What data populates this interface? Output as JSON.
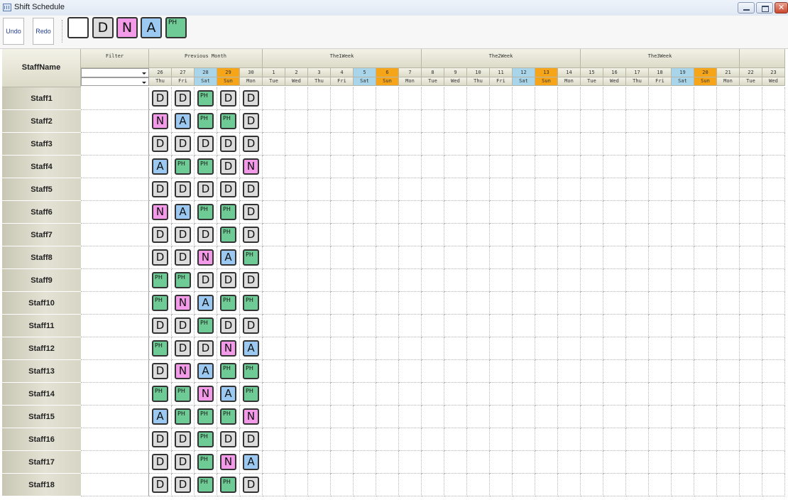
{
  "window": {
    "title": "Shift Schedule"
  },
  "toolbar": {
    "undo_label": "Undo",
    "redo_label": "Redo"
  },
  "palette": [
    {
      "code": "",
      "name": "empty"
    },
    {
      "code": "D",
      "name": "D"
    },
    {
      "code": "N",
      "name": "N"
    },
    {
      "code": "A",
      "name": "A"
    },
    {
      "code": "PH",
      "name": "PH"
    }
  ],
  "colors": {
    "D": "#dcdcdc",
    "N": "#f39ae9",
    "A": "#9cc9f1",
    "PH": "#6fcb95",
    "saturday": "#a9d5ea",
    "sunday": "#f6a418"
  },
  "grid": {
    "staff_header": "StaffName",
    "filter_header": "Filter",
    "groups": [
      "Previous Month",
      "The1Week",
      "The2Week",
      "The3Week",
      ""
    ],
    "days": [
      {
        "num": "26",
        "dow": "Thu",
        "type": "weekday"
      },
      {
        "num": "27",
        "dow": "Fri",
        "type": "weekday"
      },
      {
        "num": "28",
        "dow": "Sat",
        "type": "sat"
      },
      {
        "num": "29",
        "dow": "Sun",
        "type": "sun"
      },
      {
        "num": "30",
        "dow": "Mon",
        "type": "weekday"
      },
      {
        "num": "1",
        "dow": "Tue",
        "type": "weekday"
      },
      {
        "num": "2",
        "dow": "Wed",
        "type": "weekday"
      },
      {
        "num": "3",
        "dow": "Thu",
        "type": "weekday"
      },
      {
        "num": "4",
        "dow": "Fri",
        "type": "weekday"
      },
      {
        "num": "5",
        "dow": "Sat",
        "type": "sat"
      },
      {
        "num": "6",
        "dow": "Sun",
        "type": "sun"
      },
      {
        "num": "7",
        "dow": "Mon",
        "type": "weekday"
      },
      {
        "num": "8",
        "dow": "Tue",
        "type": "weekday"
      },
      {
        "num": "9",
        "dow": "Wed",
        "type": "weekday"
      },
      {
        "num": "10",
        "dow": "Thu",
        "type": "weekday"
      },
      {
        "num": "11",
        "dow": "Fri",
        "type": "weekday"
      },
      {
        "num": "12",
        "dow": "Sat",
        "type": "sat"
      },
      {
        "num": "13",
        "dow": "Sun",
        "type": "sun"
      },
      {
        "num": "14",
        "dow": "Mon",
        "type": "weekday"
      },
      {
        "num": "15",
        "dow": "Tue",
        "type": "weekday"
      },
      {
        "num": "16",
        "dow": "Wed",
        "type": "weekday"
      },
      {
        "num": "17",
        "dow": "Thu",
        "type": "weekday"
      },
      {
        "num": "18",
        "dow": "Fri",
        "type": "weekday"
      },
      {
        "num": "19",
        "dow": "Sat",
        "type": "sat"
      },
      {
        "num": "20",
        "dow": "Sun",
        "type": "sun"
      },
      {
        "num": "21",
        "dow": "Mon",
        "type": "weekday"
      },
      {
        "num": "22",
        "dow": "Tue",
        "type": "weekday"
      },
      {
        "num": "23",
        "dow": "Wed",
        "type": "weekday"
      }
    ],
    "staff": [
      {
        "name": "Staff1",
        "shifts": [
          "D",
          "D",
          "PH",
          "D",
          "D"
        ]
      },
      {
        "name": "Staff2",
        "shifts": [
          "N",
          "A",
          "PH",
          "PH",
          "D"
        ]
      },
      {
        "name": "Staff3",
        "shifts": [
          "D",
          "D",
          "D",
          "D",
          "D"
        ]
      },
      {
        "name": "Staff4",
        "shifts": [
          "A",
          "PH",
          "PH",
          "D",
          "N"
        ]
      },
      {
        "name": "Staff5",
        "shifts": [
          "D",
          "D",
          "D",
          "D",
          "D"
        ]
      },
      {
        "name": "Staff6",
        "shifts": [
          "N",
          "A",
          "PH",
          "PH",
          "D"
        ]
      },
      {
        "name": "Staff7",
        "shifts": [
          "D",
          "D",
          "D",
          "PH",
          "D"
        ]
      },
      {
        "name": "Staff8",
        "shifts": [
          "D",
          "D",
          "N",
          "A",
          "PH"
        ]
      },
      {
        "name": "Staff9",
        "shifts": [
          "PH",
          "PH",
          "D",
          "D",
          "D"
        ]
      },
      {
        "name": "Staff10",
        "shifts": [
          "PH",
          "N",
          "A",
          "PH",
          "PH"
        ]
      },
      {
        "name": "Staff11",
        "shifts": [
          "D",
          "D",
          "PH",
          "D",
          "D"
        ]
      },
      {
        "name": "Staff12",
        "shifts": [
          "PH",
          "D",
          "D",
          "N",
          "A"
        ]
      },
      {
        "name": "Staff13",
        "shifts": [
          "D",
          "N",
          "A",
          "PH",
          "PH"
        ]
      },
      {
        "name": "Staff14",
        "shifts": [
          "PH",
          "PH",
          "N",
          "A",
          "PH"
        ]
      },
      {
        "name": "Staff15",
        "shifts": [
          "A",
          "PH",
          "PH",
          "PH",
          "N"
        ]
      },
      {
        "name": "Staff16",
        "shifts": [
          "D",
          "D",
          "PH",
          "D",
          "D"
        ]
      },
      {
        "name": "Staff17",
        "shifts": [
          "D",
          "D",
          "PH",
          "N",
          "A"
        ]
      },
      {
        "name": "Staff18",
        "shifts": [
          "D",
          "D",
          "PH",
          "PH",
          "D"
        ]
      }
    ]
  }
}
